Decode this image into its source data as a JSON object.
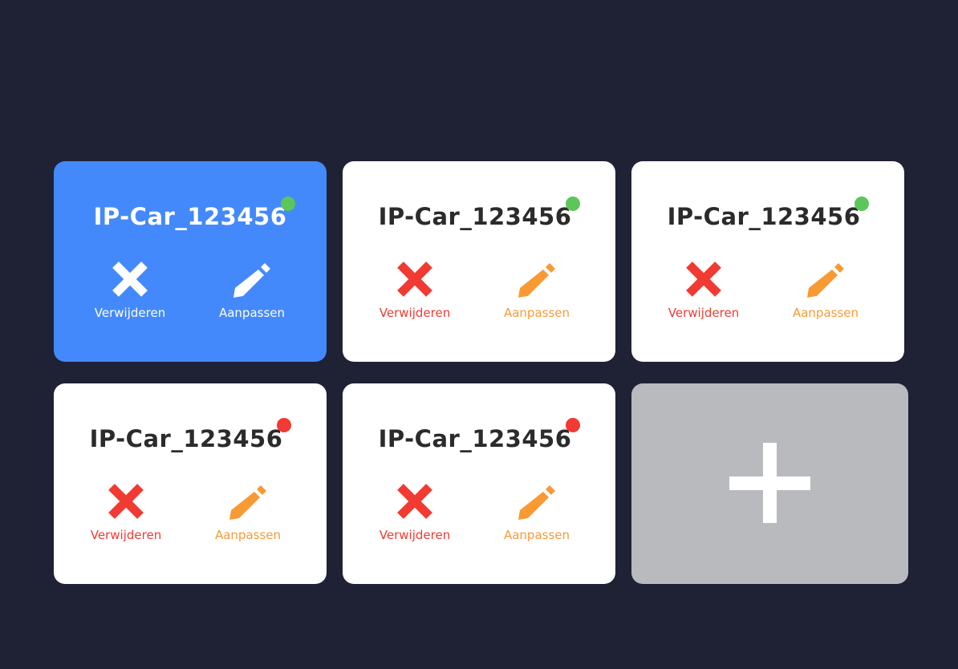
{
  "colors": {
    "background": "#1f2235",
    "selected_card": "#4489fb",
    "card": "#ffffff",
    "add_card": "#b9babe",
    "online": "#5cc65a",
    "offline": "#f13a32",
    "delete": "#f13a32",
    "edit": "#f89a34"
  },
  "devices": [
    {
      "name": "IP-Car_123456",
      "status": "online",
      "selected": true,
      "delete_label": "Verwijderen",
      "edit_label": "Aanpassen",
      "delete_icon": "close-x-icon",
      "edit_icon": "pencil-icon"
    },
    {
      "name": "IP-Car_123456",
      "status": "online",
      "selected": false,
      "delete_label": "Verwijderen",
      "edit_label": "Aanpassen",
      "delete_icon": "close-x-icon",
      "edit_icon": "pencil-icon"
    },
    {
      "name": "IP-Car_123456",
      "status": "online",
      "selected": false,
      "delete_label": "Verwijderen",
      "edit_label": "Aanpassen",
      "delete_icon": "close-x-icon",
      "edit_icon": "pencil-icon"
    },
    {
      "name": "IP-Car_123456",
      "status": "offline",
      "selected": false,
      "delete_label": "Verwijderen",
      "edit_label": "Aanpassen",
      "delete_icon": "close-x-icon",
      "edit_icon": "pencil-icon"
    },
    {
      "name": "IP-Car_123456",
      "status": "offline",
      "selected": false,
      "delete_label": "Verwijderen",
      "edit_label": "Aanpassen",
      "delete_icon": "close-x-icon",
      "edit_icon": "pencil-icon"
    }
  ],
  "add_card": {
    "icon": "plus-icon"
  }
}
